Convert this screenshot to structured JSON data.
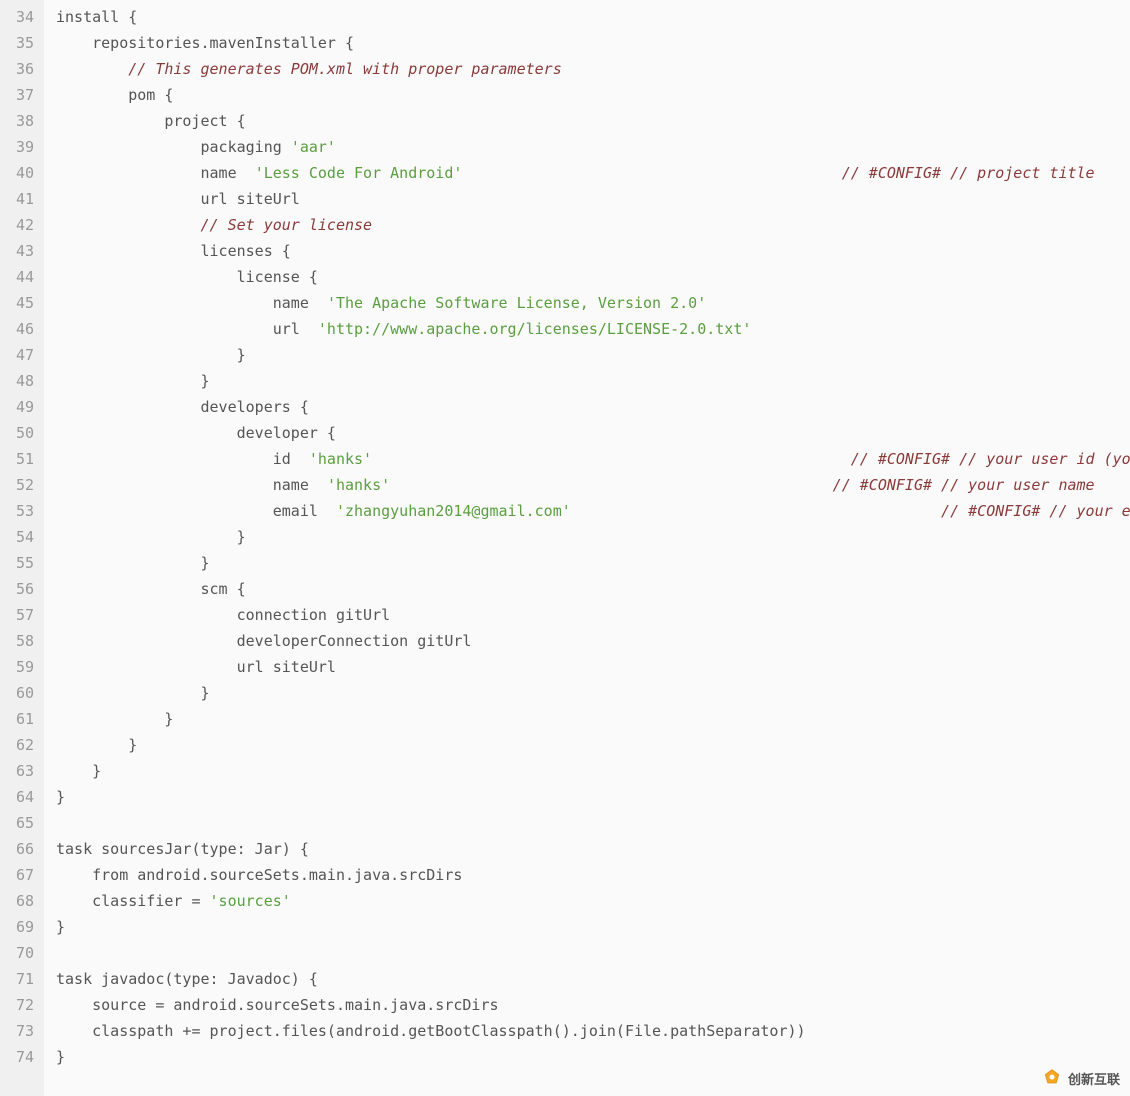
{
  "startLine": 34,
  "lines": [
    {
      "n": 34,
      "segs": [
        {
          "t": "install {",
          "cls": "c-plain"
        }
      ]
    },
    {
      "n": 35,
      "segs": [
        {
          "t": "    repositories.mavenInstaller {",
          "cls": "c-plain"
        }
      ]
    },
    {
      "n": 36,
      "segs": [
        {
          "t": "        ",
          "cls": "c-plain"
        },
        {
          "t": "// This generates POM.xml with proper parameters",
          "cls": "c-comment"
        }
      ]
    },
    {
      "n": 37,
      "segs": [
        {
          "t": "        pom {",
          "cls": "c-plain"
        }
      ]
    },
    {
      "n": 38,
      "segs": [
        {
          "t": "            project {",
          "cls": "c-plain"
        }
      ]
    },
    {
      "n": 39,
      "segs": [
        {
          "t": "                packaging ",
          "cls": "c-plain"
        },
        {
          "t": "'aar'",
          "cls": "c-string"
        }
      ]
    },
    {
      "n": 40,
      "segs": [
        {
          "t": "                name  ",
          "cls": "c-plain"
        },
        {
          "t": "'Less Code For Android'",
          "cls": "c-string"
        },
        {
          "t": "                                          ",
          "cls": "c-plain"
        },
        {
          "t": "// #CONFIG# // project title",
          "cls": "c-comment"
        }
      ]
    },
    {
      "n": 41,
      "segs": [
        {
          "t": "                url siteUrl",
          "cls": "c-plain"
        }
      ]
    },
    {
      "n": 42,
      "segs": [
        {
          "t": "                ",
          "cls": "c-plain"
        },
        {
          "t": "// Set your license",
          "cls": "c-comment"
        }
      ]
    },
    {
      "n": 43,
      "segs": [
        {
          "t": "                licenses {",
          "cls": "c-plain"
        }
      ]
    },
    {
      "n": 44,
      "segs": [
        {
          "t": "                    license {",
          "cls": "c-plain"
        }
      ]
    },
    {
      "n": 45,
      "segs": [
        {
          "t": "                        name  ",
          "cls": "c-plain"
        },
        {
          "t": "'The Apache Software License, Version 2.0'",
          "cls": "c-string"
        }
      ]
    },
    {
      "n": 46,
      "segs": [
        {
          "t": "                        url  ",
          "cls": "c-plain"
        },
        {
          "t": "'http://www.apache.org/licenses/LICENSE-2.0.txt'",
          "cls": "c-string"
        }
      ]
    },
    {
      "n": 47,
      "segs": [
        {
          "t": "                    }",
          "cls": "c-plain"
        }
      ]
    },
    {
      "n": 48,
      "segs": [
        {
          "t": "                }",
          "cls": "c-plain"
        }
      ]
    },
    {
      "n": 49,
      "segs": [
        {
          "t": "                developers {",
          "cls": "c-plain"
        }
      ]
    },
    {
      "n": 50,
      "segs": [
        {
          "t": "                    developer {",
          "cls": "c-plain"
        }
      ]
    },
    {
      "n": 51,
      "segs": [
        {
          "t": "                        id  ",
          "cls": "c-plain"
        },
        {
          "t": "'hanks'",
          "cls": "c-string"
        },
        {
          "t": "                                                     ",
          "cls": "c-plain"
        },
        {
          "t": "// #CONFIG# // your user id (you can w",
          "cls": "c-comment"
        }
      ]
    },
    {
      "n": 52,
      "segs": [
        {
          "t": "                        name  ",
          "cls": "c-plain"
        },
        {
          "t": "'hanks'",
          "cls": "c-string"
        },
        {
          "t": "                                                 ",
          "cls": "c-plain"
        },
        {
          "t": "// #CONFIG# // your user name",
          "cls": "c-comment"
        }
      ]
    },
    {
      "n": 53,
      "segs": [
        {
          "t": "                        email  ",
          "cls": "c-plain"
        },
        {
          "t": "'zhangyuhan2014@gmail.com'",
          "cls": "c-string"
        },
        {
          "t": "                                         ",
          "cls": "c-plain"
        },
        {
          "t": "// #CONFIG# // your ema",
          "cls": "c-comment"
        }
      ]
    },
    {
      "n": 54,
      "segs": [
        {
          "t": "                    }",
          "cls": "c-plain"
        }
      ]
    },
    {
      "n": 55,
      "segs": [
        {
          "t": "                }",
          "cls": "c-plain"
        }
      ]
    },
    {
      "n": 56,
      "segs": [
        {
          "t": "                scm {",
          "cls": "c-plain"
        }
      ]
    },
    {
      "n": 57,
      "segs": [
        {
          "t": "                    connection gitUrl",
          "cls": "c-plain"
        }
      ]
    },
    {
      "n": 58,
      "segs": [
        {
          "t": "                    developerConnection gitUrl",
          "cls": "c-plain"
        }
      ]
    },
    {
      "n": 59,
      "segs": [
        {
          "t": "                    url siteUrl",
          "cls": "c-plain"
        }
      ]
    },
    {
      "n": 60,
      "segs": [
        {
          "t": "                }",
          "cls": "c-plain"
        }
      ]
    },
    {
      "n": 61,
      "segs": [
        {
          "t": "            }",
          "cls": "c-plain"
        }
      ]
    },
    {
      "n": 62,
      "segs": [
        {
          "t": "        }",
          "cls": "c-plain"
        }
      ]
    },
    {
      "n": 63,
      "segs": [
        {
          "t": "    }",
          "cls": "c-plain"
        }
      ]
    },
    {
      "n": 64,
      "segs": [
        {
          "t": "}",
          "cls": "c-plain"
        }
      ]
    },
    {
      "n": 65,
      "segs": [
        {
          "t": "",
          "cls": "c-plain"
        }
      ]
    },
    {
      "n": 66,
      "segs": [
        {
          "t": "task sourcesJar(type: Jar) {",
          "cls": "c-plain"
        }
      ]
    },
    {
      "n": 67,
      "segs": [
        {
          "t": "    from android.sourceSets.main.java.srcDirs",
          "cls": "c-plain"
        }
      ]
    },
    {
      "n": 68,
      "segs": [
        {
          "t": "    classifier = ",
          "cls": "c-plain"
        },
        {
          "t": "'sources'",
          "cls": "c-string"
        }
      ]
    },
    {
      "n": 69,
      "segs": [
        {
          "t": "}",
          "cls": "c-plain"
        }
      ]
    },
    {
      "n": 70,
      "segs": [
        {
          "t": "",
          "cls": "c-plain"
        }
      ]
    },
    {
      "n": 71,
      "segs": [
        {
          "t": "task javadoc(type: Javadoc) {",
          "cls": "c-plain"
        }
      ]
    },
    {
      "n": 72,
      "segs": [
        {
          "t": "    source = android.sourceSets.main.java.srcDirs",
          "cls": "c-plain"
        }
      ]
    },
    {
      "n": 73,
      "segs": [
        {
          "t": "    classpath += project.files(android.getBootClasspath().join(File.pathSeparator))",
          "cls": "c-plain"
        }
      ]
    },
    {
      "n": 74,
      "segs": [
        {
          "t": "}",
          "cls": "c-plain"
        }
      ]
    }
  ],
  "watermark": {
    "text": "创新互联"
  }
}
